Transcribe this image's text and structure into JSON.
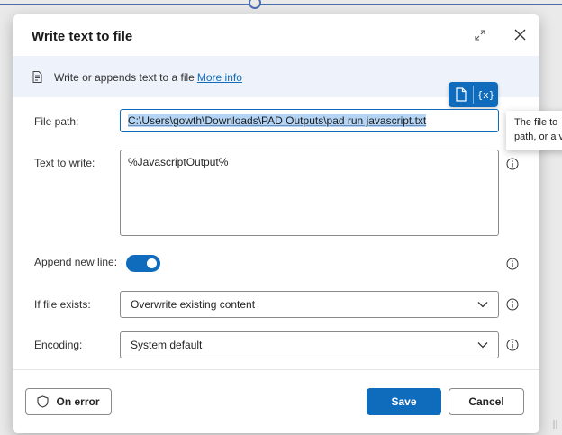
{
  "dialog": {
    "title": "Write text to file",
    "info": {
      "text": "Write or appends text to a file",
      "link": "More info"
    },
    "variable_button_label": "{x}",
    "fields": {
      "file_path": {
        "label": "File path:",
        "value": "C:\\Users\\gowth\\Downloads\\PAD Outputs\\pad run javascript.txt"
      },
      "text_to_write": {
        "label": "Text to write:",
        "value": "%JavascriptOutput%"
      },
      "append_new_line": {
        "label": "Append new line:",
        "checked": true
      },
      "if_file_exists": {
        "label": "If file exists:",
        "value": "Overwrite existing content"
      },
      "encoding": {
        "label": "Encoding:",
        "value": "System default"
      }
    },
    "tooltip": {
      "line1": "The file to",
      "line2": "path, or a v"
    },
    "footer": {
      "on_error": "On error",
      "save": "Save",
      "cancel": "Cancel"
    }
  },
  "colors": {
    "accent": "#0f6cbd",
    "info_bar": "#eef3fb"
  }
}
